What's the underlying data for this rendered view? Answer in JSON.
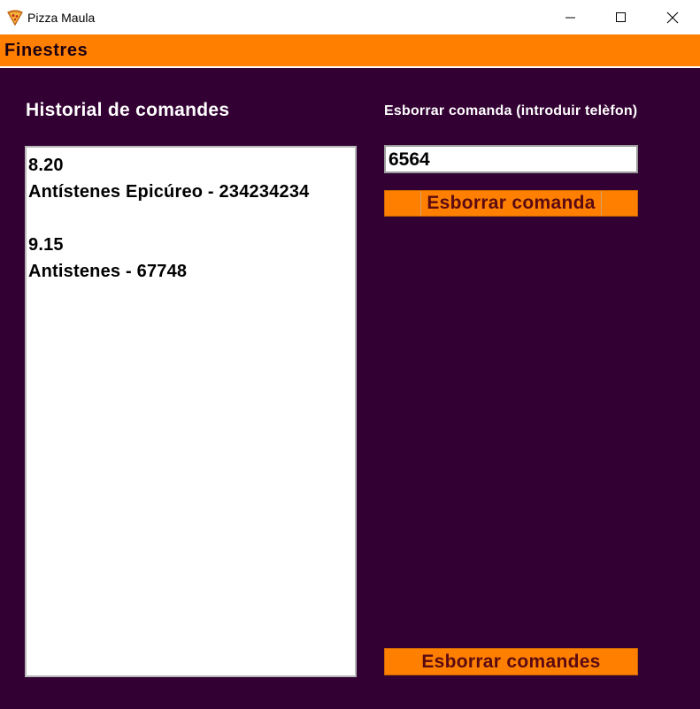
{
  "window": {
    "title": "Pizza Maula",
    "icon": "pizza-slice-icon"
  },
  "menubar": {
    "items": [
      "Finestres"
    ]
  },
  "history": {
    "title": "Historial de comandes",
    "text": "8.20\nAntístenes Epicúreo - 234234234\n\n9.15\nAntistenes - 67748"
  },
  "delete_order": {
    "label": "Esborrar comanda (introduir telèfon)",
    "phone_value": "6564",
    "button_label": "Esborrar comanda"
  },
  "delete_all": {
    "button_label": "Esborrar comandes"
  },
  "colors": {
    "background": "#330033",
    "accent": "#ff8000",
    "button_text": "#5a0a12"
  }
}
